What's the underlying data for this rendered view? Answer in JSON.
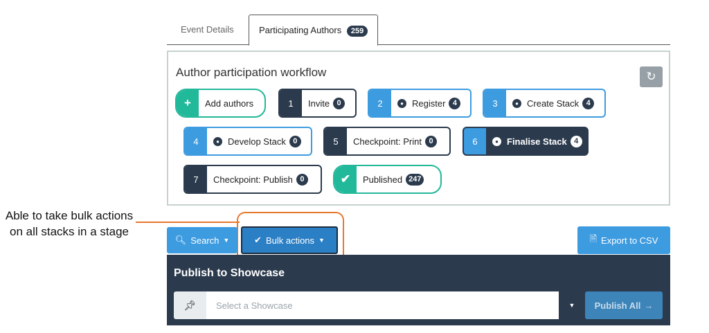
{
  "annotation": {
    "text": "Able to take bulk actions on all stacks in a stage"
  },
  "tabs": [
    {
      "label": "Event Details"
    },
    {
      "label": "Participating Authors",
      "badge": "259"
    }
  ],
  "workflow": {
    "title": "Author participation workflow",
    "refresh_icon": "refresh-icon",
    "steps": [
      {
        "num": "+",
        "label": "Add authors"
      },
      {
        "num": "1",
        "label": "Invite",
        "count": "0"
      },
      {
        "num": "2",
        "label": "Register",
        "count": "4",
        "icon": "user-icon"
      },
      {
        "num": "3",
        "label": "Create Stack",
        "count": "4",
        "icon": "user-icon"
      },
      {
        "num": "4",
        "label": "Develop Stack",
        "count": "0",
        "icon": "user-icon"
      },
      {
        "num": "5",
        "label": "Checkpoint: Print",
        "count": "0"
      },
      {
        "num": "6",
        "label": "Finalise Stack",
        "count": "4",
        "icon": "user-icon"
      },
      {
        "num": "7",
        "label": "Checkpoint: Publish",
        "count": "0"
      },
      {
        "num": "✔",
        "label": "Published",
        "count": "247"
      }
    ]
  },
  "toolbar": {
    "search_label": "Search",
    "bulk_label": "Bulk actions",
    "export_label": "Export to CSV"
  },
  "publish": {
    "title": "Publish to Showcase",
    "placeholder": "Select a Showcase",
    "button_label": "Publish All"
  },
  "colors": {
    "navy": "#2b3a4d",
    "blue": "#3d9be0",
    "green": "#22b89a",
    "annotation_orange": "#e8772e"
  }
}
